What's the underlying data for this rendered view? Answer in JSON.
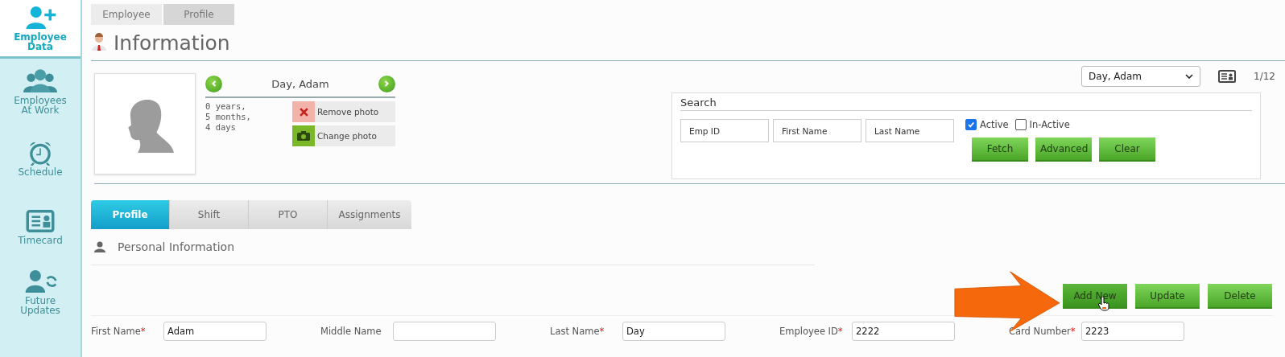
{
  "sidebar": {
    "items": [
      {
        "label": "Employee Data",
        "kind": "add-person",
        "selected": true
      },
      {
        "label": "Employees At Work",
        "kind": "group",
        "selected": false
      },
      {
        "label": "Schedule",
        "kind": "clock",
        "selected": false
      },
      {
        "label": "Timecard",
        "kind": "card",
        "selected": false
      },
      {
        "label": "Future Updates",
        "kind": "person-sync",
        "selected": false
      }
    ]
  },
  "breadcrumb": [
    {
      "label": "Employee",
      "selected": false
    },
    {
      "label": "Profile",
      "selected": true
    }
  ],
  "page_title": "Information",
  "profile": {
    "name": "Day, Adam",
    "tenure": [
      "0 years,",
      "5 months,",
      "4 days"
    ],
    "photo_actions": [
      {
        "label": "Remove photo",
        "kind": "remove"
      },
      {
        "label": "Change photo",
        "kind": "change"
      }
    ]
  },
  "employee_select": {
    "value": "Day, Adam"
  },
  "record_counter": "1/12",
  "search": {
    "title": "Search",
    "fields": [
      {
        "placeholder": "Emp ID"
      },
      {
        "placeholder": "First Name"
      },
      {
        "placeholder": "Last Name"
      }
    ],
    "filters": [
      {
        "label": "Active",
        "checked": true
      },
      {
        "label": "In-Active",
        "checked": false
      }
    ],
    "buttons": [
      "Fetch",
      "Advanced",
      "Clear"
    ]
  },
  "tabs": [
    {
      "label": "Profile",
      "selected": true
    },
    {
      "label": "Shift",
      "selected": false
    },
    {
      "label": "PTO",
      "selected": false
    },
    {
      "label": "Assignments",
      "selected": false
    }
  ],
  "section_title": "Personal Information",
  "actions": [
    {
      "label": "Add New",
      "hovered": true
    },
    {
      "label": "Update",
      "hovered": false
    },
    {
      "label": "Delete",
      "hovered": false
    }
  ],
  "form": [
    {
      "label": "First Name",
      "required_mark": "*",
      "value": "Adam"
    },
    {
      "label": "Middle Name"
    },
    {
      "label": "Last Name",
      "required_mark": "*",
      "value": "Day"
    },
    {
      "label": "Employee ID",
      "required_mark": "*",
      "value": "2222"
    },
    {
      "label": "Card Number",
      "required_mark": "*",
      "value": "2223"
    }
  ]
}
